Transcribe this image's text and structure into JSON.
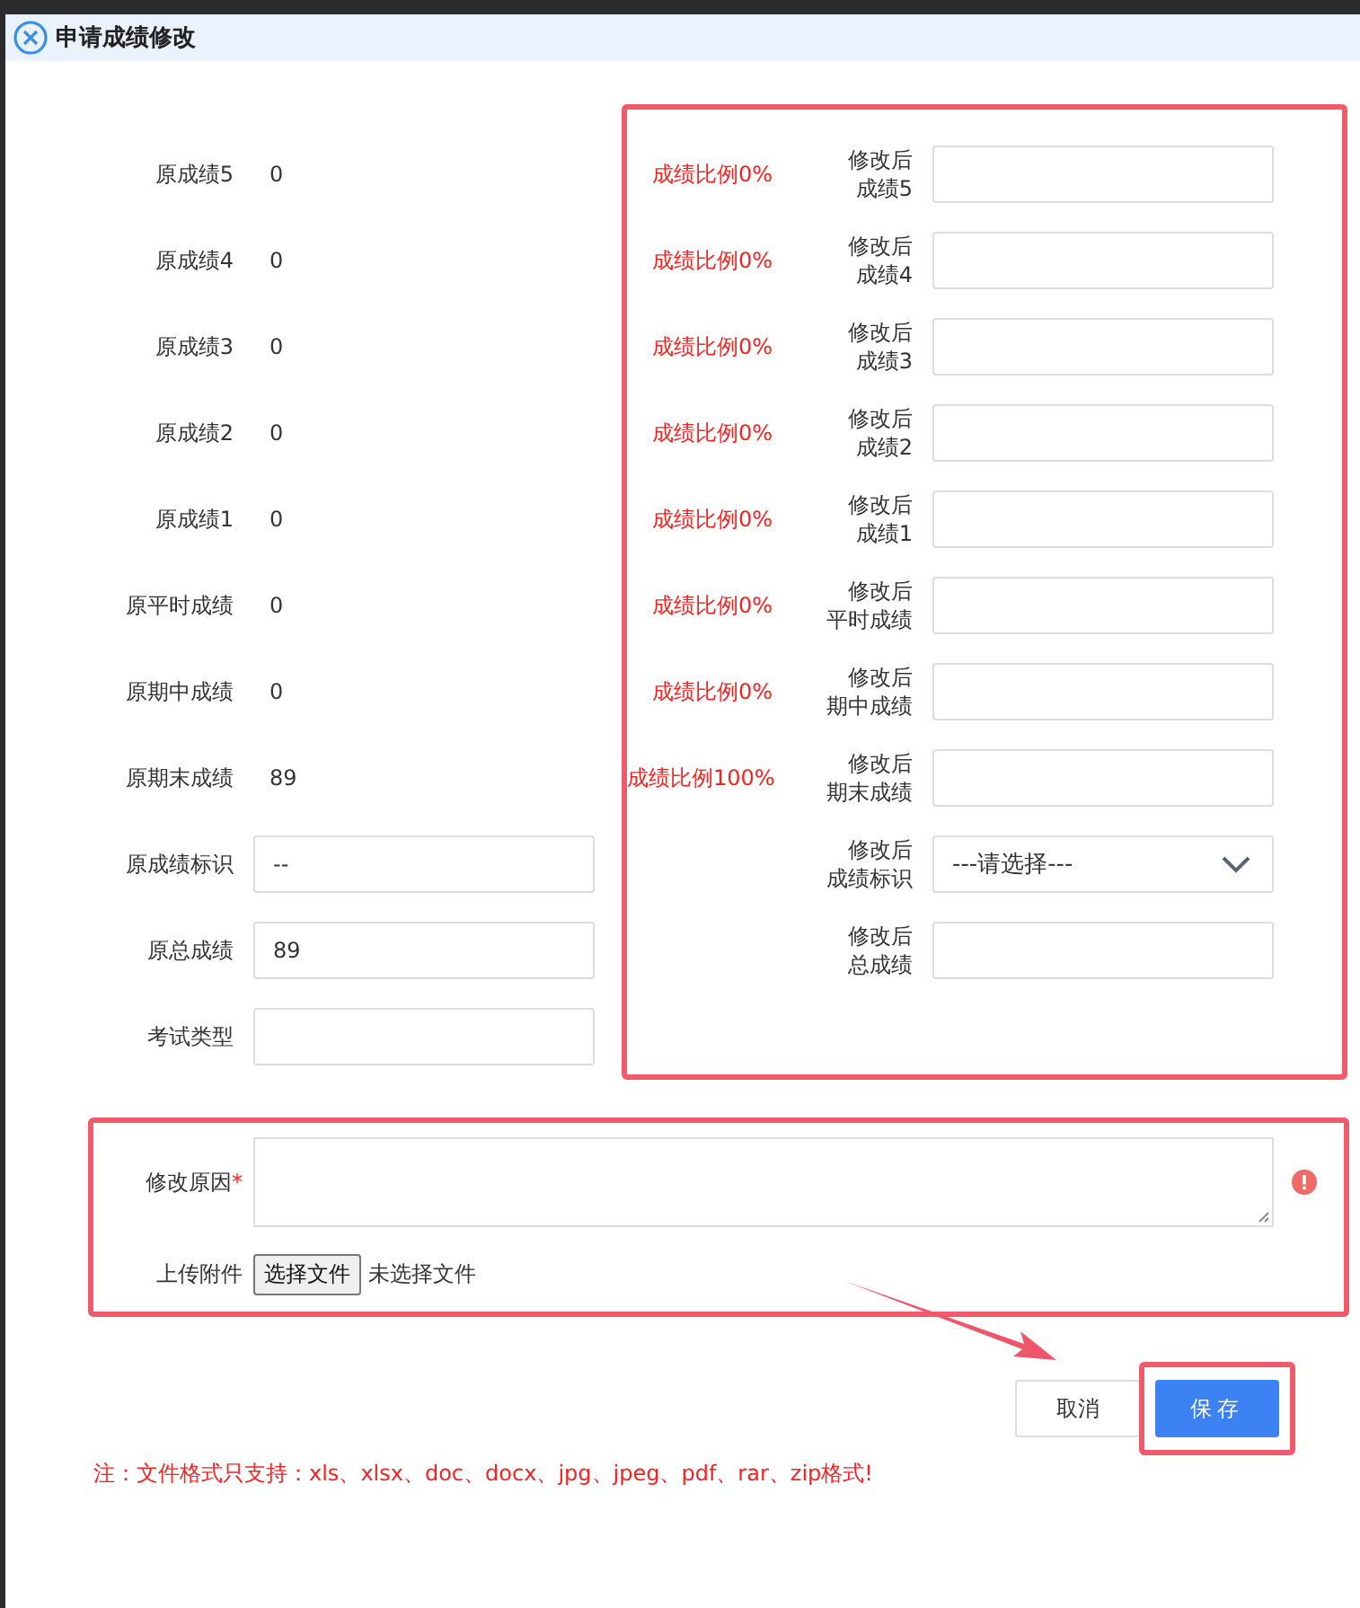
{
  "dialog": {
    "title": "申请成绩修改"
  },
  "original_scores": [
    {
      "kind": "text",
      "label": "原成绩5",
      "value": "0"
    },
    {
      "kind": "text",
      "label": "原成绩4",
      "value": "0"
    },
    {
      "kind": "text",
      "label": "原成绩3",
      "value": "0"
    },
    {
      "kind": "text",
      "label": "原成绩2",
      "value": "0"
    },
    {
      "kind": "text",
      "label": "原成绩1",
      "value": "0"
    },
    {
      "kind": "text",
      "label": "原平时成绩",
      "value": "0"
    },
    {
      "kind": "text",
      "label": "原期中成绩",
      "value": "0"
    },
    {
      "kind": "text",
      "label": "原期末成绩",
      "value": "89"
    },
    {
      "kind": "field",
      "label": "原成绩标识",
      "value": "--"
    },
    {
      "kind": "field",
      "label": "原总成绩",
      "value": "89"
    },
    {
      "kind": "field",
      "label": "考试类型"
    }
  ],
  "modified_scores": [
    {
      "kind": "input",
      "ratio": "成绩比例0%",
      "label_lines": [
        "修改后",
        "成绩5"
      ]
    },
    {
      "kind": "input",
      "ratio": "成绩比例0%",
      "label_lines": [
        "修改后",
        "成绩4"
      ]
    },
    {
      "kind": "input",
      "ratio": "成绩比例0%",
      "label_lines": [
        "修改后",
        "成绩3"
      ]
    },
    {
      "kind": "input",
      "ratio": "成绩比例0%",
      "label_lines": [
        "修改后",
        "成绩2"
      ]
    },
    {
      "kind": "input",
      "ratio": "成绩比例0%",
      "label_lines": [
        "修改后",
        "成绩1"
      ]
    },
    {
      "kind": "input",
      "ratio": "成绩比例0%",
      "label_lines": [
        "修改后",
        "平时成绩"
      ]
    },
    {
      "kind": "input",
      "ratio": "成绩比例0%",
      "label_lines": [
        "修改后",
        "期中成绩"
      ]
    },
    {
      "kind": "input",
      "ratio": "成绩比例100%",
      "label_lines": [
        "修改后",
        "期末成绩"
      ]
    },
    {
      "kind": "select",
      "label_lines": [
        "修改后",
        "成绩标识"
      ],
      "placeholder": "---请选择---"
    },
    {
      "kind": "input",
      "label_lines": [
        "修改后",
        "总成绩"
      ]
    }
  ],
  "reason": {
    "label": "修改原因",
    "required_mark": "*",
    "error": true
  },
  "upload": {
    "label": "上传附件",
    "button": "选择文件",
    "status": "未选择文件"
  },
  "buttons": [
    {
      "kind": "secondary",
      "label": "取消"
    },
    {
      "kind": "primary",
      "label": "保存"
    }
  ],
  "note": "注：文件格式只支持：xls、xlsx、doc、docx、jpg、jpeg、pdf、rar、zip格式!"
}
